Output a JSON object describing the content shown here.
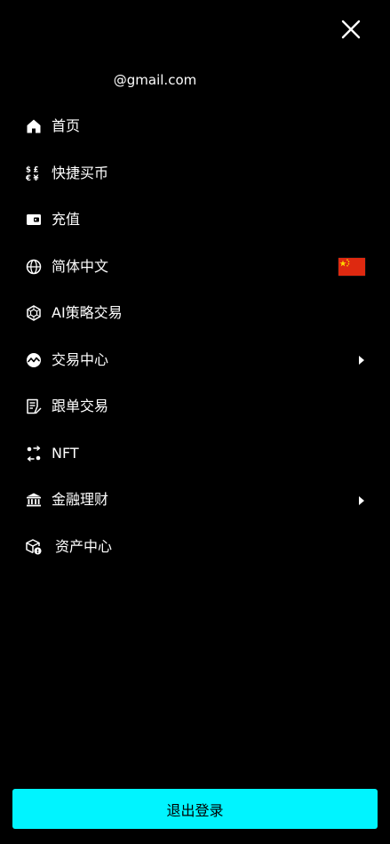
{
  "header": {
    "close_icon": "close-icon",
    "email": "@gmail.com"
  },
  "menu": {
    "items": [
      {
        "label": "首页",
        "icon": "home-icon"
      },
      {
        "label": "快捷买币",
        "icon": "currency-exchange-icon"
      },
      {
        "label": "充值",
        "icon": "wallet-icon"
      },
      {
        "label": "简体中文",
        "icon": "globe-icon",
        "flag": "china-flag-icon"
      },
      {
        "label": "AI策略交易",
        "icon": "hexagon-ai-icon"
      },
      {
        "label": "交易中心",
        "icon": "trade-chart-icon",
        "expandable": true
      },
      {
        "label": "跟单交易",
        "icon": "document-edit-icon"
      },
      {
        "label": "NFT",
        "icon": "nft-swap-icon"
      },
      {
        "label": "金融理财",
        "icon": "bank-icon",
        "expandable": true
      },
      {
        "label": "资产中心",
        "icon": "asset-cube-icon"
      }
    ]
  },
  "footer": {
    "logout_label": "退出登录"
  },
  "colors": {
    "background": "#000000",
    "text": "#ffffff",
    "accent": "#00f4ff",
    "flag_red": "#de2910",
    "flag_yellow": "#ffde00"
  }
}
